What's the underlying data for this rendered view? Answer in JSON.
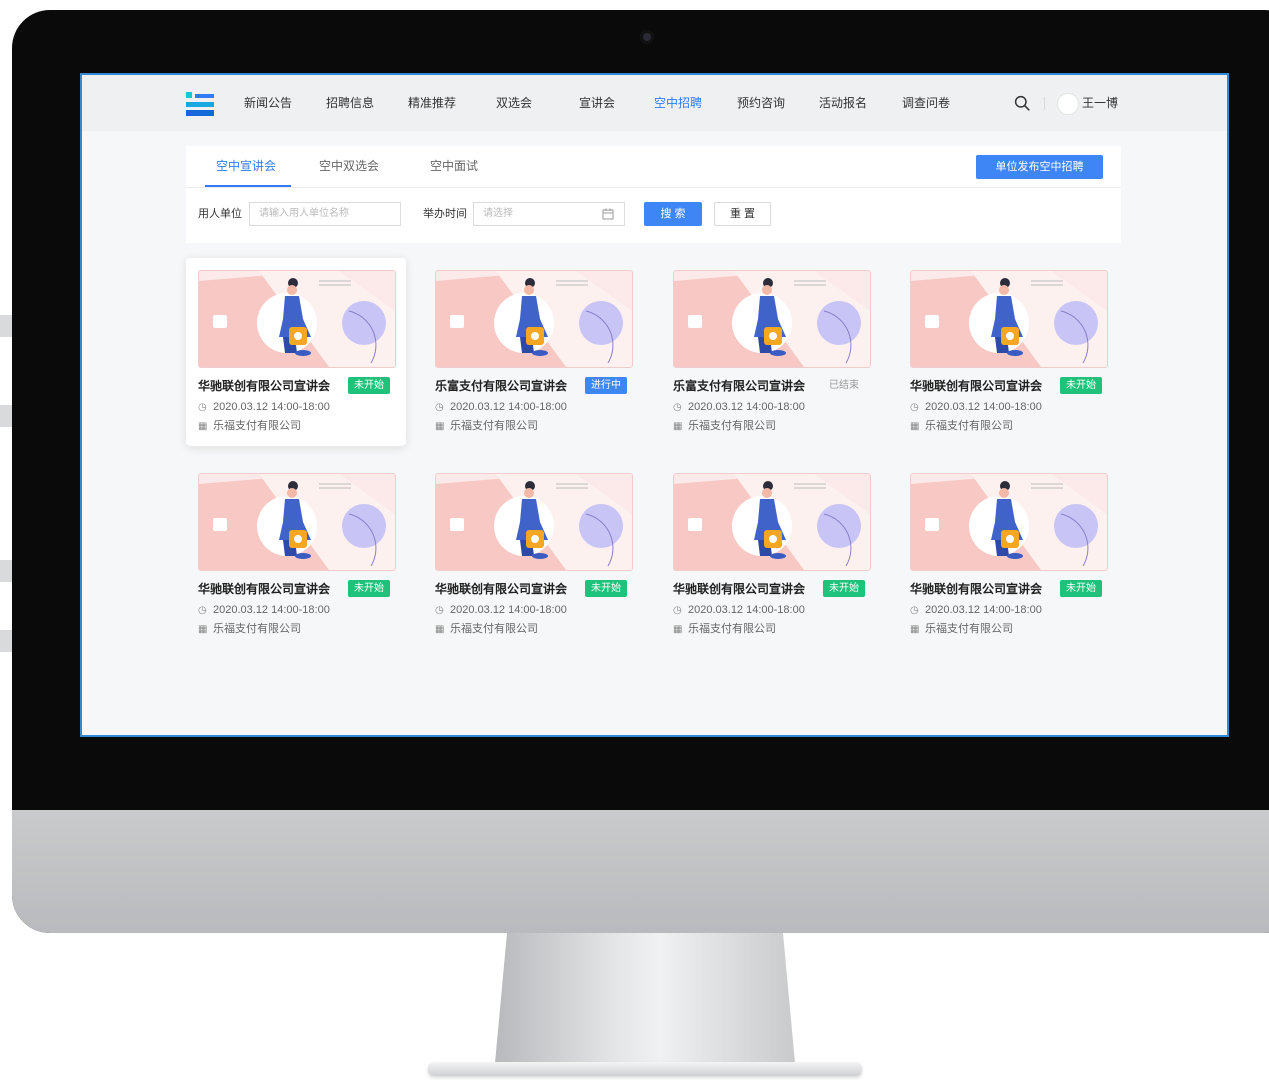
{
  "colors": {
    "accent": "#2f7cf6",
    "primary_button": "#3e86f5",
    "badge_not_started": "#1fc27a",
    "badge_in_progress": "#3e86f5",
    "badge_ended_text": "#999999",
    "screen_border": "#2e8bd8"
  },
  "header": {
    "nav": [
      {
        "label": "新闻公告",
        "active": false
      },
      {
        "label": "招聘信息",
        "active": false
      },
      {
        "label": "精准推荐",
        "active": false
      },
      {
        "label": "双选会",
        "active": false
      },
      {
        "label": "宣讲会",
        "active": false
      },
      {
        "label": "空中招聘",
        "active": true
      },
      {
        "label": "预约咨询",
        "active": false
      },
      {
        "label": "活动报名",
        "active": false
      },
      {
        "label": "调查问卷",
        "active": false
      }
    ],
    "search_icon": "search-icon",
    "user_name": "王一博"
  },
  "tabs": [
    {
      "label": "空中宣讲会",
      "active": true
    },
    {
      "label": "空中双选会",
      "active": false
    },
    {
      "label": "空中面试",
      "active": false
    }
  ],
  "publish_button": "单位发布空中招聘",
  "filters": {
    "employer_label": "用人单位",
    "employer_placeholder": "请输入用人单位名称",
    "time_label": "举办时间",
    "time_placeholder": "请选择",
    "calendar_icon": "calendar-icon",
    "search_button": "搜 索",
    "reset_button": "重 置"
  },
  "cards": [
    {
      "title": "华驰联创有限公司宣讲会",
      "status": "未开始",
      "status_type": "not_started",
      "time": "2020.03.12 14:00-18:00",
      "company": "乐福支付有限公司"
    },
    {
      "title": "乐富支付有限公司宣讲会",
      "status": "进行中",
      "status_type": "in_progress",
      "time": "2020.03.12 14:00-18:00",
      "company": "乐福支付有限公司"
    },
    {
      "title": "乐富支付有限公司宣讲会",
      "status": "已结束",
      "status_type": "ended",
      "time": "2020.03.12 14:00-18:00",
      "company": "乐福支付有限公司"
    },
    {
      "title": "华驰联创有限公司宣讲会",
      "status": "未开始",
      "status_type": "not_started",
      "time": "2020.03.12 14:00-18:00",
      "company": "乐福支付有限公司"
    },
    {
      "title": "华驰联创有限公司宣讲会",
      "status": "未开始",
      "status_type": "not_started",
      "time": "2020.03.12 14:00-18:00",
      "company": "乐福支付有限公司"
    },
    {
      "title": "华驰联创有限公司宣讲会",
      "status": "未开始",
      "status_type": "not_started",
      "time": "2020.03.12 14:00-18:00",
      "company": "乐福支付有限公司"
    },
    {
      "title": "华驰联创有限公司宣讲会",
      "status": "未开始",
      "status_type": "not_started",
      "time": "2020.03.12 14:00-18:00",
      "company": "乐福支付有限公司"
    },
    {
      "title": "华驰联创有限公司宣讲会",
      "status": "未开始",
      "status_type": "not_started",
      "time": "2020.03.12 14:00-18:00",
      "company": "乐福支付有限公司"
    }
  ],
  "card_icons": {
    "time": "clock-icon",
    "company": "building-icon"
  }
}
